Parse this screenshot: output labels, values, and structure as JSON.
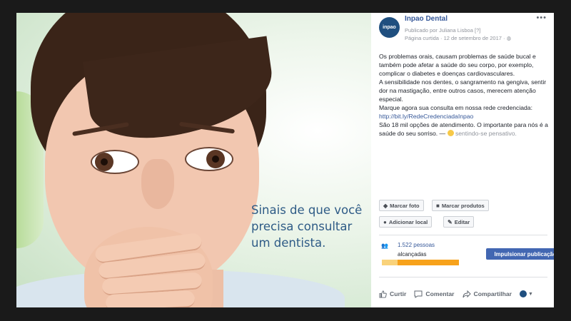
{
  "photo": {
    "caption_lines": [
      "Sinais de que você",
      "precisa consultar",
      "um dentista."
    ]
  },
  "post": {
    "page_name": "Inpao Dental",
    "published_by": "Publicado por Juliana Lisboa [?]",
    "page_liked": "Página curtida · 12 de setembro de 2017 · ",
    "avatar_text": "inpao",
    "body": {
      "line1": "Os problemas orais, causam problemas de saúde bucal e também pode afetar a saúde do seu corpo, por exemplo, complicar o diabetes e doenças cardiovasculares.",
      "line2": "A sensibilidade nos dentes, o sangramento na gengiva, sentir dor na mastigação, entre outros casos, merecem atenção especial.",
      "line3_prefix": "Marque agora sua consulta em nossa rede credenciada: ",
      "link": "http://bit.ly/RedeCredenciadaInpao",
      "line4": "São 18 mil opções de atendimento. O importante para nós é a saúde do seu sorriso. — ",
      "feeling": "sentindo-se pensativo."
    },
    "buttons": {
      "tag_photo": "Marcar foto",
      "tag_products": "Marcar produtos",
      "add_location": "Adicionar local",
      "edit": "Editar"
    },
    "reach": {
      "count": "1.522 pessoas",
      "label": "alcançadas",
      "organic_fraction": 0.2
    },
    "boost_label": "Impulsionar publicação",
    "actions": {
      "like": "Curtir",
      "comment": "Comentar",
      "share": "Compartilhar"
    },
    "colors": {
      "link": "#365899",
      "boost": "#4267b2",
      "reach_bar": "#f7a21b",
      "caption": "#2e5b86"
    }
  }
}
